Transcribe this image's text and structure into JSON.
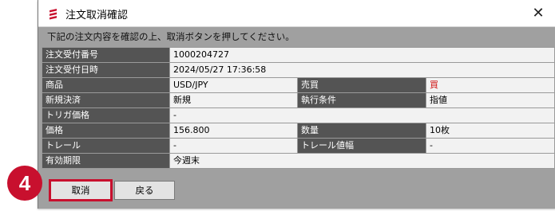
{
  "window": {
    "title": "注文取消確認",
    "close_glyph": "✕",
    "icon": "app-logo-icon"
  },
  "instruction": "下記の注文内容を確認の上、取消ボタンを押してください。",
  "order": {
    "receipt_no_label": "注文受付番号",
    "receipt_no": "1000204727",
    "receipt_time_label": "注文受付日時",
    "receipt_time": "2024/05/27 17:36:58",
    "product_label": "商品",
    "product": "USD/JPY",
    "side_label": "売買",
    "side": "買",
    "settlement_label": "新規決済",
    "settlement": "新規",
    "condition_label": "執行条件",
    "condition": "指値",
    "trigger_label": "トリガ価格",
    "trigger": "-",
    "price_label": "価格",
    "price": "156.800",
    "qty_label": "数量",
    "qty": "10枚",
    "trail_label": "トレール",
    "trail": "-",
    "trail_width_label": "トレール値幅",
    "trail_width": "-",
    "expiry_label": "有効期限",
    "expiry": "今週末"
  },
  "buttons": {
    "cancel": "取消",
    "back": "戻る"
  },
  "annotation": {
    "step": "4"
  },
  "colors": {
    "label_bg": "#545454",
    "value_bg": "#f2f2f2",
    "buy_red": "#d01010",
    "highlight": "#c8102e"
  }
}
